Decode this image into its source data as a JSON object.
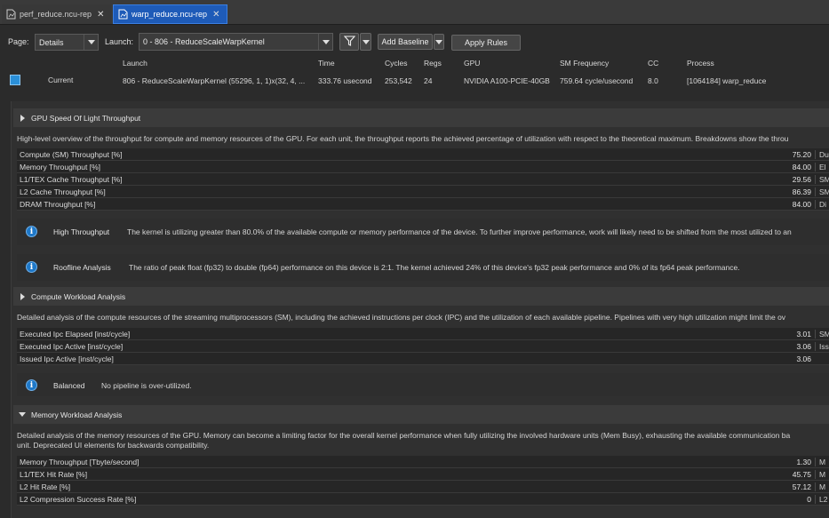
{
  "tabs": [
    {
      "label": "perf_reduce.ncu-rep",
      "close": "✕"
    },
    {
      "label": "warp_reduce.ncu-rep",
      "close": "✕"
    }
  ],
  "toolbar": {
    "page_label": "Page:",
    "page_value": "Details",
    "launch_label": "Launch:",
    "launch_value": "0 -  806 - ReduceScaleWarpKernel",
    "add_baseline": "Add Baseline",
    "apply_rules": "Apply Rules"
  },
  "header": {
    "columns": [
      "Launch",
      "Time",
      "Cycles",
      "Regs",
      "GPU",
      "SM Frequency",
      "CC",
      "Process"
    ],
    "current_label": "Current",
    "values": [
      "806 - ReduceScaleWarpKernel (55296, 1, 1)x(32, 4, ...",
      "333.76 usecond",
      "253,542",
      "24",
      "NVIDIA A100-PCIE-40GB",
      "759.64 cycle/usecond",
      "8.0",
      "[1064184] warp_reduce"
    ]
  },
  "sections": {
    "sol": {
      "title": "GPU Speed Of Light Throughput",
      "description": "High-level overview of the throughput for compute and memory resources of the GPU. For each unit, the throughput reports the achieved percentage of utilization with respect to the theoretical maximum. Breakdowns show the throu",
      "rows": [
        {
          "name": "Compute (SM) Throughput [%]",
          "value": "75.20",
          "next": "Du"
        },
        {
          "name": "Memory Throughput [%]",
          "value": "84.00",
          "next": "El"
        },
        {
          "name": "L1/TEX Cache Throughput [%]",
          "value": "29.56",
          "next": "SM"
        },
        {
          "name": "L2 Cache Throughput [%]",
          "value": "86.39",
          "next": "SM"
        },
        {
          "name": "DRAM Throughput [%]",
          "value": "84.00",
          "next": "Di"
        }
      ],
      "rules": [
        {
          "title": "High Throughput",
          "text": "The kernel is utilizing greater than 80.0% of the available compute or memory performance of the device. To further improve performance, work will likely need to be shifted from the most utilized to an"
        },
        {
          "title": "Roofline Analysis",
          "text": "The ratio of peak float (fp32) to double (fp64) performance on this device is 2:1. The kernel achieved 24% of this device's fp32 peak performance and 0% of its fp64 peak performance."
        }
      ]
    },
    "compute": {
      "title": "Compute Workload Analysis",
      "description": "Detailed analysis of the compute resources of the streaming multiprocessors (SM), including the achieved instructions per clock (IPC) and the utilization of each available pipeline. Pipelines with very high utilization might limit the ov",
      "rows": [
        {
          "name": "Executed Ipc Elapsed [inst/cycle]",
          "value": "3.01",
          "next": "SM"
        },
        {
          "name": "Executed Ipc Active [inst/cycle]",
          "value": "3.06",
          "next": "Iss"
        },
        {
          "name": "Issued Ipc Active [inst/cycle]",
          "value": "3.06",
          "next": ""
        }
      ],
      "rules": [
        {
          "title": "Balanced",
          "text": "No pipeline is over-utilized."
        }
      ]
    },
    "memory": {
      "title": "Memory Workload Analysis",
      "description_line1": "Detailed analysis of the memory resources of the GPU. Memory can become a limiting factor for the overall kernel performance when fully utilizing the involved hardware units (Mem Busy), exhausting the available communication ba",
      "description_line2": "unit. Deprecated UI elements for backwards compatibility.",
      "rows": [
        {
          "name": "Memory Throughput [Tbyte/second]",
          "value": "1.30",
          "next": "M"
        },
        {
          "name": "L1/TEX Hit Rate [%]",
          "value": "45.75",
          "next": "M"
        },
        {
          "name": "L2 Hit Rate [%]",
          "value": "57.12",
          "next": "M"
        },
        {
          "name": "L2 Compression Success Rate [%]",
          "value": "0",
          "next": "L2"
        }
      ]
    }
  },
  "colors": {
    "active_tab": "#1e5bb8",
    "current_swatch": "#2a8fd8",
    "info_icon": "#1e78c8"
  },
  "icons": [
    "document-icon",
    "filter-icon",
    "info-icon",
    "expand-arrow-icon"
  ]
}
